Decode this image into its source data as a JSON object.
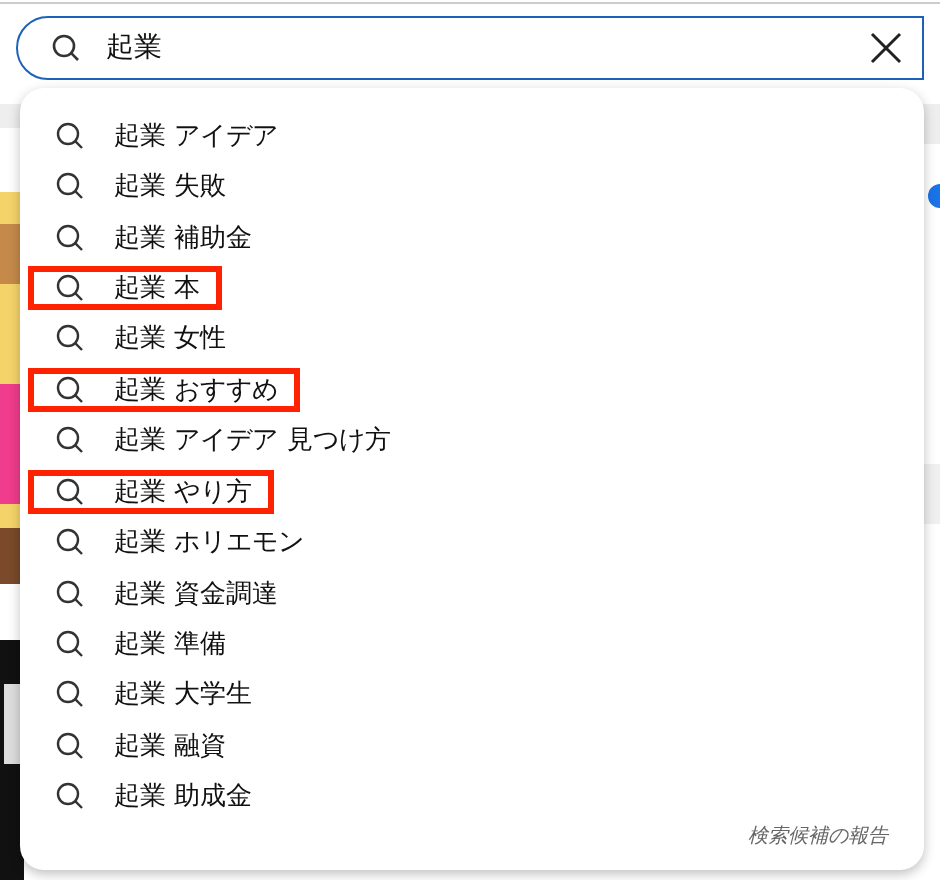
{
  "search": {
    "value": "起業 "
  },
  "suggestions": [
    {
      "text": "起業 アイデア",
      "highlighted": false
    },
    {
      "text": "起業 失敗",
      "highlighted": false
    },
    {
      "text": "起業 補助金",
      "highlighted": false
    },
    {
      "text": "起業 本",
      "highlighted": true
    },
    {
      "text": "起業 女性",
      "highlighted": false
    },
    {
      "text": "起業 おすすめ",
      "highlighted": true
    },
    {
      "text": "起業 アイデア 見つけ方",
      "highlighted": false
    },
    {
      "text": "起業 やり方",
      "highlighted": true
    },
    {
      "text": "起業 ホリエモン",
      "highlighted": false
    },
    {
      "text": "起業 資金調達",
      "highlighted": false
    },
    {
      "text": "起業 準備",
      "highlighted": false
    },
    {
      "text": "起業 大学生",
      "highlighted": false
    },
    {
      "text": "起業 融資",
      "highlighted": false
    },
    {
      "text": "起業 助成金",
      "highlighted": false
    }
  ],
  "report_link": "検索候補の報告"
}
